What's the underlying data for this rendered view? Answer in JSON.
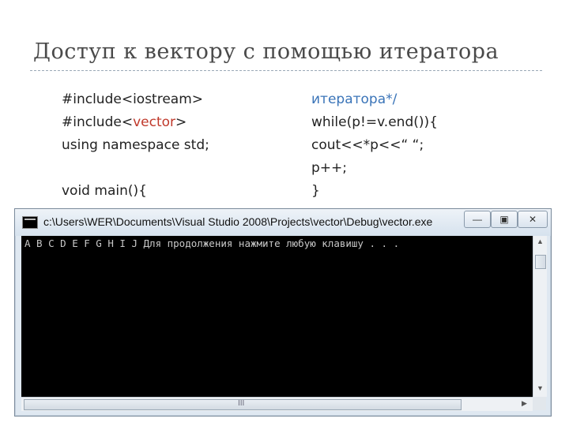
{
  "slide": {
    "title": "Доступ к вектору с помощью итератора"
  },
  "code": {
    "left": [
      {
        "parts": [
          {
            "text": "#include<iostream>",
            "color": ""
          }
        ]
      },
      {
        "parts": [
          {
            "text": "#include<",
            "color": ""
          },
          {
            "text": "vector",
            "color": "#c0392b"
          },
          {
            "text": ">",
            "color": ""
          }
        ]
      },
      {
        "parts": [
          {
            "text": "using namespace std;",
            "color": ""
          }
        ]
      },
      {
        "parts": [
          {
            "text": "",
            "color": ""
          }
        ]
      },
      {
        "parts": [
          {
            "text": "void main(){",
            "color": ""
          }
        ]
      }
    ],
    "right": [
      {
        "parts": [
          {
            "text": "итератора*/",
            "color": "#3a74b8"
          }
        ]
      },
      {
        "parts": [
          {
            "text": "while(p!=v.end()){",
            "color": ""
          }
        ]
      },
      {
        "parts": [
          {
            "text": "cout<<*p<<“ “;",
            "color": ""
          }
        ]
      },
      {
        "parts": [
          {
            "text": "p++;",
            "color": ""
          }
        ]
      },
      {
        "parts": [
          {
            "text": "}",
            "color": ""
          }
        ]
      }
    ]
  },
  "console": {
    "title": "c:\\Users\\WER\\Documents\\Visual Studio 2008\\Projects\\vector\\Debug\\vector.exe",
    "output": "A B C D E F G H I J Для продолжения нажмите любую клавишу . . .",
    "minimize_glyph": "—",
    "maximize_glyph": "▣",
    "close_glyph": "✕",
    "hscroll_grip": "III"
  },
  "colors": {
    "keyword_red": "#c0392b",
    "comment_blue": "#3a74b8",
    "console_bg": "#000000",
    "console_text": "#c8c8c8"
  }
}
